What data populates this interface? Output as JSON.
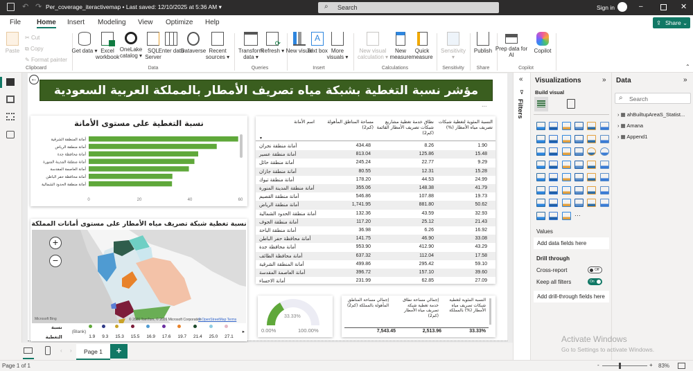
{
  "titlebar": {
    "file": "Per_coverage_iteractivemap • Last saved: 12/10/2025 at 5:36 AM ▾",
    "search": "Search",
    "sign_in": "Sign in"
  },
  "menu": [
    "File",
    "Home",
    "Insert",
    "Modeling",
    "View",
    "Optimize",
    "Help"
  ],
  "share": "Share",
  "ribbon": {
    "clipboard": {
      "paste": "Paste",
      "cut": "Cut",
      "copy": "Copy",
      "format_painter": "Format painter",
      "label": "Clipboard"
    },
    "data": {
      "get_data": "Get data ▾",
      "excel": "Excel workbook",
      "onelake": "OneLake catalog ▾",
      "sql": "SQL Server",
      "enter": "Enter data",
      "dataverse": "Dataverse",
      "recent": "Recent sources ▾",
      "label": "Data"
    },
    "queries": {
      "transform": "Transform data ▾",
      "refresh": "Refresh ▾",
      "label": "Queries"
    },
    "insert": {
      "new_visual": "New visual",
      "text_box": "Text box",
      "more_visuals": "More visuals ▾",
      "label": "Insert"
    },
    "calculations": {
      "new_visual_calc": "New visual calculation ▾",
      "new_measure": "New measure",
      "quick_measure": "Quick measure",
      "label": "Calculations"
    },
    "sensitivity": {
      "btn": "Sensitivity ▾",
      "label": "Sensitivity"
    },
    "share": {
      "publish": "Publish",
      "label": "Share"
    },
    "copilot": {
      "prep": "Prep data for AI",
      "copilot": "Copilot",
      "label": "Copilot"
    }
  },
  "report": {
    "title": "مؤشر نسبة التغطية بشبكة مياه تصريف الأمطار بالمملكة العربية السعودية",
    "more": "...",
    "bar_title": "نسبة التغطية على مستوى الأمانة",
    "map_title": "نسبة تغطية شبكة تصريف مياه الأمطار على مستوى أمانات المملكة",
    "map_footer": {
      "bing": "Microsoft Bing",
      "copyright": "© 2026 TomTom, © 2026 Microsoft Corporation",
      "osm": "© OpenStreetMap Terms"
    },
    "legend": {
      "title": "نسبة التغطية",
      "blank": "(Blank)",
      "items": [
        {
          "label": "1.9",
          "color": "#5fa83a"
        },
        {
          "label": "9.3",
          "color": "#2f3a86"
        },
        {
          "label": "15.3",
          "color": "#c9a227"
        },
        {
          "label": "15.5",
          "color": "#7d1d3a"
        },
        {
          "label": "16.9",
          "color": "#4f9bd2"
        },
        {
          "label": "17.6",
          "color": "#6a2fa0"
        },
        {
          "label": "19.7",
          "color": "#e8822a"
        },
        {
          "label": "21.4",
          "color": "#1d4a2c"
        },
        {
          "label": "25.0",
          "color": "#8fcbe2"
        },
        {
          "label": "27.1",
          "color": "#e5b9c6"
        }
      ]
    },
    "table": {
      "headers": [
        "اسم الأمانة",
        "مساحة المناطق المأهولة (كم2)",
        "نطاق خدمة تغطية مشاريع شبكات تصريف الأمطار القائمة (كم2)",
        "النسبة المئوية لتغطية شبكات تصريف مياه الأمطار (%)"
      ],
      "rows": [
        [
          "أمانة منطقة نجران",
          "434.48",
          "8.26",
          "1.90"
        ],
        [
          "أمانة منطقة عسير",
          "813.04",
          "125.86",
          "15.48"
        ],
        [
          "أمانة منطقة حائل",
          "245.24",
          "22.77",
          "9.29"
        ],
        [
          "أمانة منطقة جازان",
          "80.55",
          "12.31",
          "15.28"
        ],
        [
          "أمانة منطقة تبوك",
          "178.20",
          "44.53",
          "24.99"
        ],
        [
          "أمانة منطقة المدينة المنورة",
          "355.06",
          "148.38",
          "41.79"
        ],
        [
          "أمانة منطقة القصيم",
          "546.86",
          "107.88",
          "19.73"
        ],
        [
          "أمانة منطقة الرياض",
          "1,741.95",
          "881.80",
          "50.62"
        ],
        [
          "أمانة منطقة الحدود الشمالية",
          "132.36",
          "43.59",
          "32.93"
        ],
        [
          "أمانة منطقة الجوف",
          "117.20",
          "25.12",
          "21.43"
        ],
        [
          "أمانة منطقة الباحة",
          "36.98",
          "6.26",
          "16.92"
        ],
        [
          "أمانة محافظة حفر الباطن",
          "141.75",
          "46.90",
          "33.08"
        ],
        [
          "أمانة محافظة جدة",
          "953.90",
          "412.90",
          "43.29"
        ],
        [
          "أمانة محافظة الطائف",
          "637.32",
          "112.04",
          "17.58"
        ],
        [
          "أمانة المنطقة الشرقية",
          "499.86",
          "295.42",
          "59.10"
        ],
        [
          "أمانة العاصمة المقدسة",
          "396.72",
          "157.10",
          "39.60"
        ],
        [
          "أمانة الاحساء",
          "231.99",
          "62.85",
          "27.09"
        ]
      ]
    },
    "gauge": {
      "value": 33.33,
      "value_label": "33.33%",
      "min": "0.00%",
      "max": "100.00%",
      "color": "#5fa83a"
    },
    "summary": {
      "headers": [
        "إجمالي مساحة المناطق المأهولة بالمملكة (كم2)",
        "إجمالي مساحة نطاق خدمة تغطية شبكة تصريف مياه الأمطار (كم2)",
        "النسبة المئوية لتغطية شبكات تصريف مياه الأمطار (%) بالمملكة"
      ],
      "values": [
        "7,543.45",
        "2,513.96",
        "33.33%"
      ]
    }
  },
  "chart_data": {
    "type": "bar",
    "orientation": "horizontal",
    "title": "نسبة التغطية على مستوى الأمانة",
    "categories": [
      "أمانة المنطقة الشرقية",
      "أمانة منطقة الرياض",
      "أمانة محافظة جدة",
      "أمانة منطقة المدينة المنورة",
      "أمانة العاصمة المقدسة",
      "أمانة محافظة حفر الباطن",
      "أمانة منطقة الحدود الشمالية"
    ],
    "values": [
      59.1,
      50.62,
      43.29,
      41.79,
      39.6,
      33.08,
      32.93
    ],
    "xlim": [
      0,
      60
    ],
    "xticks": [
      "0",
      "20",
      "40",
      "60"
    ],
    "color": "#5fa83a"
  },
  "filters": {
    "label": "Filters"
  },
  "viz": {
    "title": "Visualizations",
    "build": "Build visual",
    "values": "Values",
    "values_well": "Add data fields here",
    "drill": "Drill through",
    "cross": "Cross-report",
    "cross_state": "Off",
    "keep": "Keep all filters",
    "keep_state": "On",
    "drill_well": "Add drill-through fields here",
    "icons": [
      "stacked-bar",
      "stacked-column",
      "clustered-bar",
      "clustered-column",
      "100-bar",
      "100-column",
      "line-chart",
      "area-chart",
      "stacked-area",
      "100-area",
      "line-column",
      "line-clustered-column",
      "ribbon-chart",
      "waterfall",
      "funnel",
      "scatter",
      "pie",
      "donut",
      "treemap",
      "map",
      "filled-map",
      "azure-map",
      "gauge",
      "shape-map",
      "card",
      "multi-row-card",
      "kpi",
      "slicer",
      "table",
      "matrix",
      "r-visual",
      "python-visual",
      "key-influencers",
      "decomposition-tree",
      "qa",
      "narrative",
      "goals",
      "paginated",
      "power-apps",
      "power-automate",
      "button-slicer",
      "image",
      "list-slicer",
      "text-slicer",
      "chevron-visual",
      "more"
    ]
  },
  "datapane": {
    "title": "Data",
    "search": "Search",
    "tables": [
      "ahBuiltupAreaS_Statist...",
      "Amana",
      "Append1"
    ]
  },
  "pages": {
    "tab": "Page 1",
    "add": "+",
    "status": "Page 1 of 1",
    "zoom": "83%"
  },
  "watermark": {
    "line1": "Activate Windows",
    "line2": "Go to Settings to activate Windows."
  }
}
